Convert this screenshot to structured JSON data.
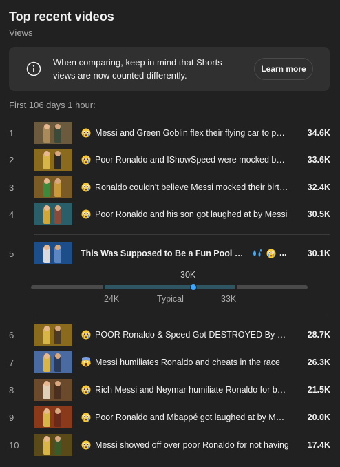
{
  "header": {
    "title": "Top recent videos",
    "subtitle": "Views"
  },
  "notice": {
    "text": "When comparing, keep in mind that Shorts views are now counted differently.",
    "button_label": "Learn more",
    "icon": "info-icon"
  },
  "period_label": "First 106 days 1 hour:",
  "videos": [
    {
      "rank": "1",
      "title": "Messi and Green Goblin flex their flying car to poor Ronaldo",
      "views": "34.6K",
      "emoji": "crying-face",
      "thumb_colors": [
        "#6b5a3e",
        "#a88a5b",
        "#3c4a3a"
      ]
    },
    {
      "rank": "2",
      "title": "Poor Ronaldo and IShowSpeed were mocked by Messi",
      "views": "33.6K",
      "emoji": "crying-face",
      "thumb_colors": [
        "#8a6b1e",
        "#d7b548",
        "#2c2a26"
      ]
    },
    {
      "rank": "3",
      "title": "Ronaldo couldn't believe Messi mocked their birthday",
      "views": "32.4K",
      "emoji": "crying-face",
      "thumb_colors": [
        "#7a5a25",
        "#3f8a3a",
        "#c99a3a"
      ]
    },
    {
      "rank": "4",
      "title": "Poor Ronaldo and his son got laughed at by Messi",
      "views": "30.5K",
      "emoji": "crying-face",
      "thumb_colors": [
        "#2a5f6a",
        "#d2a73a",
        "#8a4a3a"
      ]
    },
    {
      "rank": "5",
      "title": "This Was Supposed to Be a Fun Pool Day...",
      "views": "30.1K",
      "emoji": "crying-face",
      "thumb_colors": [
        "#1d4e8a",
        "#d9d9e0",
        "#5b86c2"
      ]
    },
    {
      "rank": "6",
      "title": "POOR Ronaldo & Speed Got DESTROYED By Messi",
      "views": "28.7K",
      "emoji": "crying-face",
      "thumb_colors": [
        "#8a6b1e",
        "#d7b548",
        "#4a3a26"
      ]
    },
    {
      "rank": "7",
      "title": "Messi humiliates Ronaldo and cheats in the race",
      "views": "26.3K",
      "emoji": "screaming-face",
      "thumb_colors": [
        "#4a6aa2",
        "#d7b548",
        "#2a3a5a"
      ]
    },
    {
      "rank": "8",
      "title": "Rich Messi and Neymar humiliate Ronaldo for being poor",
      "views": "21.5K",
      "emoji": "crying-face",
      "thumb_colors": [
        "#6a4a2a",
        "#e0d0b8",
        "#4a3020"
      ]
    },
    {
      "rank": "9",
      "title": "Poor Ronaldo and Mbappé got laughed at by Messi",
      "views": "20.0K",
      "emoji": "crying-face",
      "thumb_colors": [
        "#8a3a1a",
        "#d7b548",
        "#6a2a1a"
      ]
    },
    {
      "rank": "10",
      "title": "Messi showed off over poor Ronaldo for not having",
      "views": "17.4K",
      "emoji": "crying-face",
      "thumb_colors": [
        "#5a4a1a",
        "#d7b548",
        "#3a5a2a"
      ]
    }
  ],
  "range": {
    "top_label": "30K",
    "low_label": "24K",
    "typical_label": "Typical",
    "high_label": "33K",
    "low_value": 24000,
    "high_value": 33000,
    "marker_value": 30100,
    "accent": "#3ea6ff"
  },
  "highlight_extra_emoji": "sweat-droplets"
}
